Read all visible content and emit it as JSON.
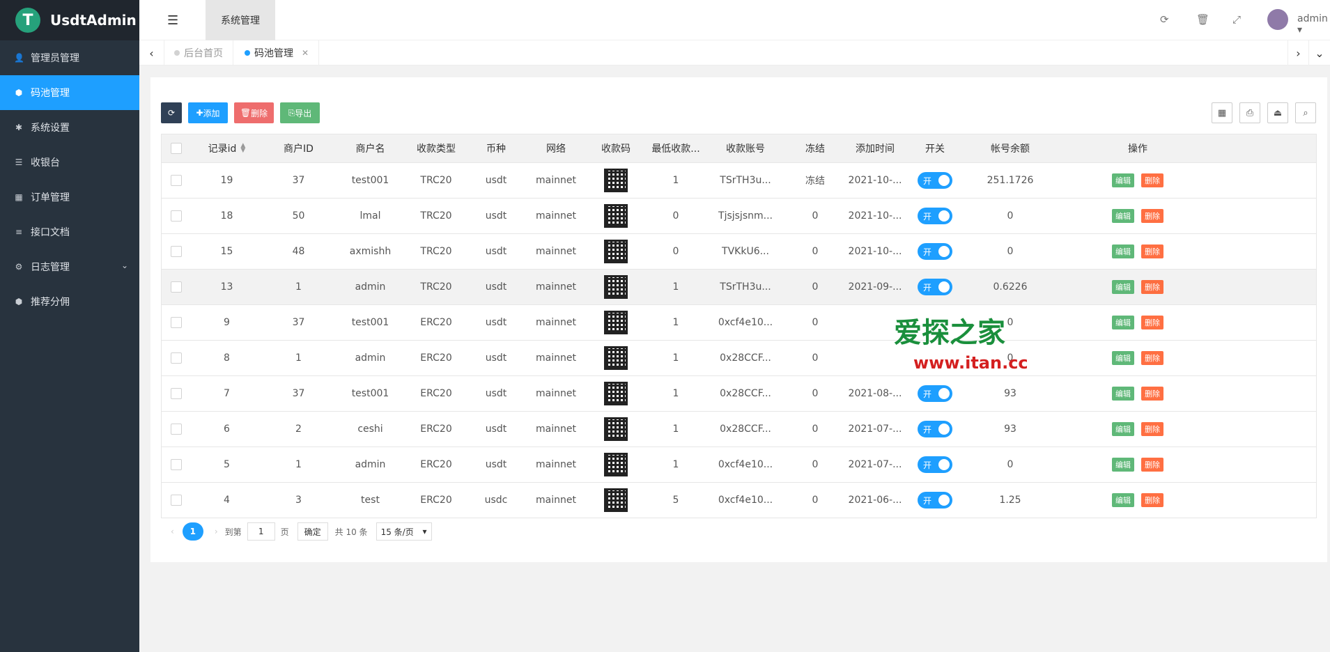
{
  "app": {
    "logo_glyph": "T",
    "name": "UsdtAdmin"
  },
  "sidebar": {
    "items": [
      {
        "label": "管理员管理",
        "icon": "user-icon"
      },
      {
        "label": "码池管理",
        "icon": "android-icon",
        "active": true
      },
      {
        "label": "系统设置",
        "icon": "gear-icon"
      },
      {
        "label": "收银台",
        "icon": "list-icon"
      },
      {
        "label": "订单管理",
        "icon": "calculator-icon"
      },
      {
        "label": "接口文档",
        "icon": "document-icon"
      },
      {
        "label": "日志管理",
        "icon": "settings-icon"
      },
      {
        "label": "推荐分佣",
        "icon": "android-icon"
      }
    ]
  },
  "header": {
    "tab": "系统管理",
    "user": "admin"
  },
  "tabs": [
    {
      "label": "后台首页"
    },
    {
      "label": "码池管理",
      "active": true
    }
  ],
  "toolbar": {
    "add": "添加",
    "delete": "删除",
    "export": "导出"
  },
  "table": {
    "columns": [
      "记录id",
      "商户ID",
      "商户名",
      "收款类型",
      "币种",
      "网络",
      "收款码",
      "最低收款...",
      "收款账号",
      "冻结",
      "添加时间",
      "开关",
      "帐号余额",
      "操作"
    ],
    "rows": [
      {
        "id": "19",
        "merchant_id": "37",
        "merchant": "test001",
        "type": "TRC20",
        "coin": "usdt",
        "net": "mainnet",
        "min": "1",
        "account": "TSrTH3u...",
        "frozen": "冻结",
        "time": "2021-10-...",
        "switch": "开",
        "balance": "251.1726"
      },
      {
        "id": "18",
        "merchant_id": "50",
        "merchant": "lmal",
        "type": "TRC20",
        "coin": "usdt",
        "net": "mainnet",
        "min": "0",
        "account": "Tjsjsjsnm...",
        "frozen": "0",
        "time": "2021-10-...",
        "switch": "开",
        "balance": "0"
      },
      {
        "id": "15",
        "merchant_id": "48",
        "merchant": "axmishh",
        "type": "TRC20",
        "coin": "usdt",
        "net": "mainnet",
        "min": "0",
        "account": "TVKkU6...",
        "frozen": "0",
        "time": "2021-10-...",
        "switch": "开",
        "balance": "0"
      },
      {
        "id": "13",
        "merchant_id": "1",
        "merchant": "admin",
        "type": "TRC20",
        "coin": "usdt",
        "net": "mainnet",
        "min": "1",
        "account": "TSrTH3u...",
        "frozen": "0",
        "time": "2021-09-...",
        "switch": "开",
        "balance": "0.6226"
      },
      {
        "id": "9",
        "merchant_id": "37",
        "merchant": "test001",
        "type": "ERC20",
        "coin": "usdt",
        "net": "mainnet",
        "min": "1",
        "account": "0xcf4e10...",
        "frozen": "0",
        "time": "",
        "switch": "",
        "balance": "0"
      },
      {
        "id": "8",
        "merchant_id": "1",
        "merchant": "admin",
        "type": "ERC20",
        "coin": "usdt",
        "net": "mainnet",
        "min": "1",
        "account": "0x28CCF...",
        "frozen": "0",
        "time": "",
        "switch": "",
        "balance": "0"
      },
      {
        "id": "7",
        "merchant_id": "37",
        "merchant": "test001",
        "type": "ERC20",
        "coin": "usdt",
        "net": "mainnet",
        "min": "1",
        "account": "0x28CCF...",
        "frozen": "0",
        "time": "2021-08-...",
        "switch": "开",
        "balance": "93"
      },
      {
        "id": "6",
        "merchant_id": "2",
        "merchant": "ceshi",
        "type": "ERC20",
        "coin": "usdt",
        "net": "mainnet",
        "min": "1",
        "account": "0x28CCF...",
        "frozen": "0",
        "time": "2021-07-...",
        "switch": "开",
        "balance": "93"
      },
      {
        "id": "5",
        "merchant_id": "1",
        "merchant": "admin",
        "type": "ERC20",
        "coin": "usdt",
        "net": "mainnet",
        "min": "1",
        "account": "0xcf4e10...",
        "frozen": "0",
        "time": "2021-07-...",
        "switch": "开",
        "balance": "0"
      },
      {
        "id": "4",
        "merchant_id": "3",
        "merchant": "test",
        "type": "ERC20",
        "coin": "usdc",
        "net": "mainnet",
        "min": "5",
        "account": "0xcf4e10...",
        "frozen": "0",
        "time": "2021-06-...",
        "switch": "开",
        "balance": "1.25"
      }
    ],
    "actions": {
      "edit": "编辑",
      "delete": "删除"
    }
  },
  "pager": {
    "current": "1",
    "goto": "到第",
    "page_input": "1",
    "page_unit": "页",
    "confirm": "确定",
    "total": "共 10 条",
    "per_page": "15 条/页"
  },
  "watermark": {
    "cn": "爱探之家",
    "url": "www.itan.cc"
  },
  "colors": {
    "primary": "#1e9fff",
    "sidebar": "#28333e",
    "edit": "#5fb878",
    "delete": "#ff5722",
    "add": "#1e9fff",
    "del_btn": "#ee6d6d",
    "export": "#5fb878"
  }
}
